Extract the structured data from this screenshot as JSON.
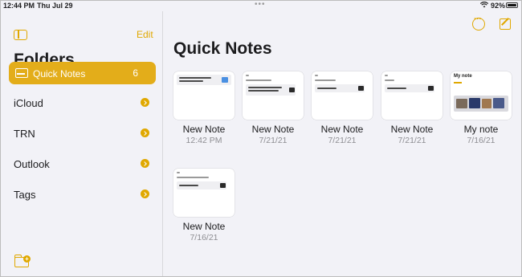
{
  "status_bar": {
    "time": "12:44 PM",
    "date": "Thu Jul 29",
    "multitask_dots": "•••",
    "battery_percent": "92%",
    "battery_level": 0.92
  },
  "sidebar": {
    "edit_label": "Edit",
    "title": "Folders",
    "items": [
      {
        "label": "Quick Notes",
        "count": "6",
        "selected": true,
        "icon": "quick-notes-icon"
      },
      {
        "label": "iCloud",
        "selected": false,
        "icon": "chevron-right-icon"
      },
      {
        "label": "TRN",
        "selected": false,
        "icon": "chevron-right-icon"
      },
      {
        "label": "Outlook",
        "selected": false,
        "icon": "chevron-right-icon"
      },
      {
        "label": "Tags",
        "selected": false,
        "icon": "chevron-right-icon"
      }
    ],
    "new_folder_icon": "new-folder-icon"
  },
  "main": {
    "title": "Quick Notes",
    "toolbar_icons": [
      "more-options-icon",
      "compose-icon"
    ],
    "notes": [
      {
        "name": "New Note",
        "date": "12:42 PM"
      },
      {
        "name": "New Note",
        "date": "7/21/21"
      },
      {
        "name": "New Note",
        "date": "7/21/21"
      },
      {
        "name": "New Note",
        "date": "7/21/21"
      },
      {
        "name": "My note",
        "date": "7/16/21",
        "thumb_title": "My note"
      },
      {
        "name": "New Note",
        "date": "7/16/21"
      }
    ]
  },
  "colors": {
    "accent": "#e0a800",
    "selected_bg": "#e3ad1a",
    "background": "#f2f2f7",
    "secondary_text": "#8e8e93"
  }
}
